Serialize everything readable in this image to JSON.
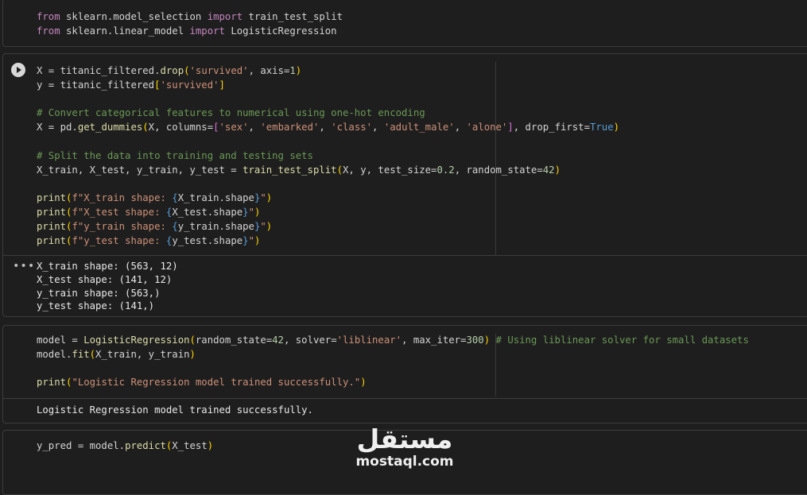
{
  "cells": {
    "c1": {
      "l1": {
        "t1": "from",
        "t2": " sklearn.model_selection ",
        "t3": "import",
        "t4": " train_test_split"
      },
      "l2": {
        "t1": "from",
        "t2": " sklearn.linear_model ",
        "t3": "import",
        "t4": " LogisticRegression"
      }
    },
    "c2": {
      "l1": {
        "a": "X = titanic_filtered.",
        "b": "drop",
        "c": "(",
        "d": "'survived'",
        "e": ", axis=",
        "f": "1",
        "g": ")"
      },
      "l2": {
        "a": "y = titanic_filtered",
        "b": "[",
        "c": "'survived'",
        "d": "]"
      },
      "l3": "# Convert categorical features to numerical using one-hot encoding",
      "l4": {
        "a": "X = pd.",
        "b": "get_dummies",
        "c": "(",
        "d": "X, columns=",
        "e": "[",
        "f": "'sex'",
        "g": ", ",
        "h": "'embarked'",
        "i": ", ",
        "j": "'class'",
        "k": ", ",
        "l": "'adult_male'",
        "m": ", ",
        "n": "'alone'",
        "o": "]",
        "p": ", drop_first=",
        "q": "True",
        "r": ")"
      },
      "l5": "# Split the data into training and testing sets",
      "l6": {
        "a": "X_train, X_test, y_train, y_test = ",
        "b": "train_test_split",
        "c": "(",
        "d": "X, y, test_size=",
        "e": "0.2",
        "f": ", random_state=",
        "g": "42",
        "h": ")"
      },
      "l7": {
        "a": "print",
        "b": "(",
        "c": "f\"X_train shape: ",
        "d": "{",
        "e": "X_train.shape",
        "f": "}",
        "g": "\"",
        "h": ")"
      },
      "l8": {
        "a": "print",
        "b": "(",
        "c": "f\"X_test shape: ",
        "d": "{",
        "e": "X_test.shape",
        "f": "}",
        "g": "\"",
        "h": ")"
      },
      "l9": {
        "a": "print",
        "b": "(",
        "c": "f\"y_train shape: ",
        "d": "{",
        "e": "y_train.shape",
        "f": "}",
        "g": "\"",
        "h": ")"
      },
      "l10": {
        "a": "print",
        "b": "(",
        "c": "f\"y_test shape: ",
        "d": "{",
        "e": "y_test.shape",
        "f": "}",
        "g": "\"",
        "h": ")"
      },
      "output": [
        "X_train shape: (563, 12)",
        "X_test shape: (141, 12)",
        "y_train shape: (563,)",
        "y_test shape: (141,)"
      ],
      "more_label": "•••"
    },
    "c3": {
      "l1": {
        "a": "model = ",
        "b": "LogisticRegression",
        "c": "(",
        "d": "random_state=",
        "e": "42",
        "f": ", solver=",
        "g": "'liblinear'",
        "h": ", max_iter=",
        "i": "300",
        "j": ")",
        "k": " # Using liblinear solver for small datasets"
      },
      "l2": {
        "a": "model.",
        "b": "fit",
        "c": "(",
        "d": "X_train, y_train",
        "e": ")"
      },
      "l3": {
        "a": "print",
        "b": "(",
        "c": "\"Logistic Regression model trained successfully.\"",
        "d": ")"
      },
      "output": "Logistic Regression model trained successfully."
    },
    "c4": {
      "l1": {
        "a": "y_pred = model.",
        "b": "predict",
        "c": "(",
        "d": "X_test",
        "e": ")"
      }
    }
  },
  "watermark": {
    "logo_text": "مستقل",
    "domain": "mostaql.com"
  },
  "colors": {
    "background": "#1e1e1e",
    "keyword": "#c586c0",
    "function": "#dcdcaa",
    "string": "#ce9178",
    "comment": "#6a9955",
    "number": "#b5cea8"
  },
  "icons": {
    "run": "play-circle-icon",
    "output_menu": "more-horizontal-icon"
  }
}
